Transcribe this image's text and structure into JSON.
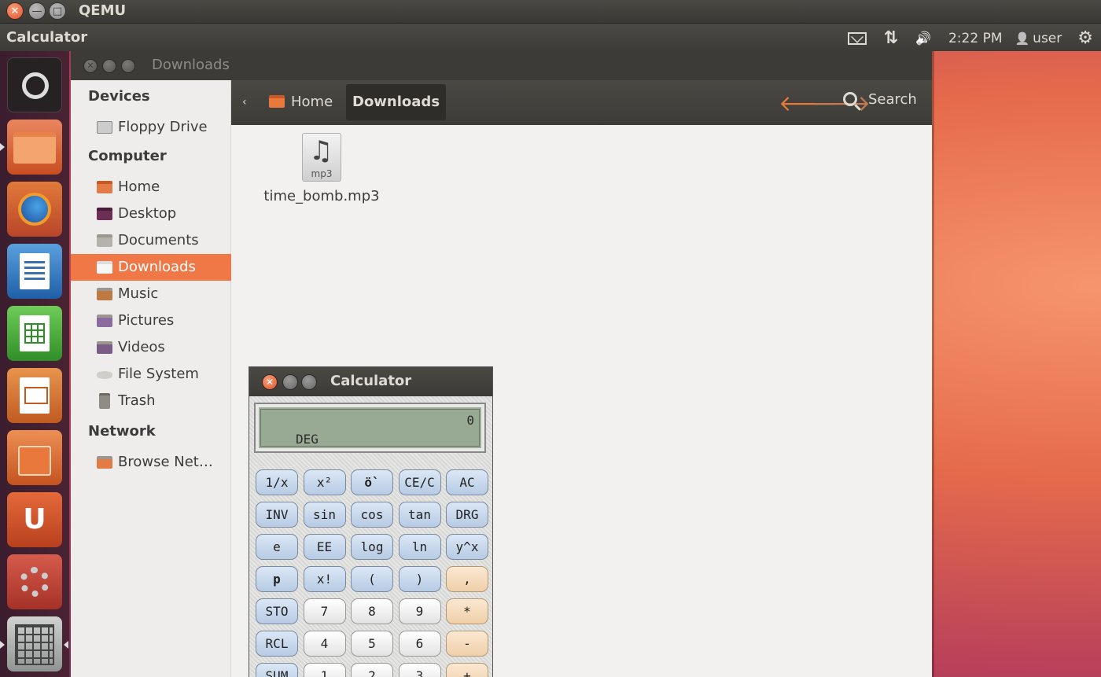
{
  "qemu": {
    "title": "QEMU",
    "close": "✕",
    "min": "—",
    "max": "□"
  },
  "panel": {
    "app_name": "Calculator",
    "indicators": {
      "network": "⇅",
      "sound": "🔊",
      "time": "2:22 PM",
      "user_icon": "👤",
      "user": "user",
      "session": "⚙"
    }
  },
  "launcher": {
    "items": [
      "dash-home",
      "files",
      "firefox",
      "libreoffice-writer",
      "libreoffice-calc",
      "libreoffice-impress",
      "ubuntu-software-center",
      "ubuntu-one",
      "system-settings",
      "calculator"
    ],
    "ubuntuone_glyph": "U"
  },
  "file_manager": {
    "title": "Downloads",
    "breadcrumb_back": "‹",
    "breadcrumb": [
      {
        "label": "Home"
      },
      {
        "label": "Downloads"
      }
    ],
    "nav_back": "🡐",
    "nav_fwd": "🡒",
    "search_label": "Search",
    "sidebar": {
      "sections": [
        {
          "heading": "Devices",
          "items": [
            "Floppy Drive"
          ]
        },
        {
          "heading": "Computer",
          "items": [
            "Home",
            "Desktop",
            "Documents",
            "Downloads",
            "Music",
            "Pictures",
            "Videos",
            "File System",
            "Trash"
          ]
        },
        {
          "heading": "Network",
          "items": [
            "Browse Net…"
          ]
        }
      ],
      "selected": "Downloads"
    },
    "files": [
      {
        "name": "time_bomb.mp3",
        "ext": "mp3",
        "glyph": "♫"
      }
    ]
  },
  "calculator": {
    "title": "Calculator",
    "display_value": "0",
    "display_mode": "DEG",
    "buttons": [
      [
        "1/x",
        "x²",
        "ö`",
        "CE/C",
        "AC"
      ],
      [
        "INV",
        "sin",
        "cos",
        "tan",
        "DRG"
      ],
      [
        "e",
        "EE",
        "log",
        "ln",
        "y^x"
      ],
      [
        "p",
        "x!",
        "(",
        ")",
        ","
      ],
      [
        "STO",
        "7",
        "8",
        "9",
        "*"
      ],
      [
        "RCL",
        "4",
        "5",
        "6",
        "-"
      ],
      [
        "SUM",
        "1",
        "2",
        "3",
        "+"
      ]
    ]
  }
}
